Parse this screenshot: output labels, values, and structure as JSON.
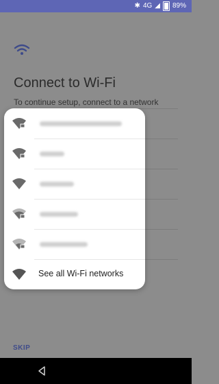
{
  "status_bar": {
    "bluetooth_icon": "bluetooth-icon",
    "network_label": "4G",
    "signal_icon": "signal-icon",
    "battery_icon": "battery-icon",
    "battery_percent": "89%"
  },
  "setup": {
    "title": "Connect to Wi-Fi",
    "subtitle": "To continue setup, connect to a network",
    "skip_label": "SKIP"
  },
  "networks_popup": {
    "see_all_label": "See all Wi-Fi networks"
  },
  "colors": {
    "status_bar": "#5e66b5",
    "accent": "#3e4b8a",
    "dim_background": "#8c8c8c"
  }
}
